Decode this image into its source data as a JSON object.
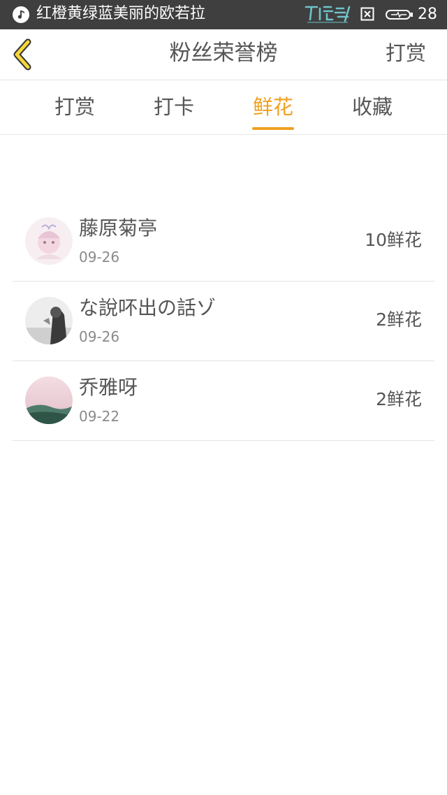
{
  "status_bar": {
    "title": "红橙黄绿蓝美丽的欧若拉",
    "battery": "28",
    "icons": [
      "music-note-icon",
      "hatsune-miku-logo",
      "close-box-icon",
      "battery-icon"
    ]
  },
  "nav": {
    "title": "粉丝荣誉榜",
    "action_label": "打赏",
    "back_icon": "chevron-left-icon"
  },
  "tabs": [
    {
      "label": "打赏",
      "active": false
    },
    {
      "label": "打卡",
      "active": false
    },
    {
      "label": "鲜花",
      "active": true
    },
    {
      "label": "收藏",
      "active": false
    }
  ],
  "colors": {
    "accent": "#f0a020",
    "text": "#555555",
    "subtext": "#8a8a8a",
    "status_bar": "#3f3f3f",
    "divider": "#e3e3e3"
  },
  "list": [
    {
      "name": "藤原菊亭",
      "date": "09-26",
      "count": "10鲜花",
      "avatar": "anime-avatar"
    },
    {
      "name": "な說吥出の話ゾ",
      "date": "09-26",
      "count": "2鲜花",
      "avatar": "bw-photo-avatar"
    },
    {
      "name": "乔雅呀",
      "date": "09-22",
      "count": "2鲜花",
      "avatar": "landscape-avatar"
    }
  ]
}
